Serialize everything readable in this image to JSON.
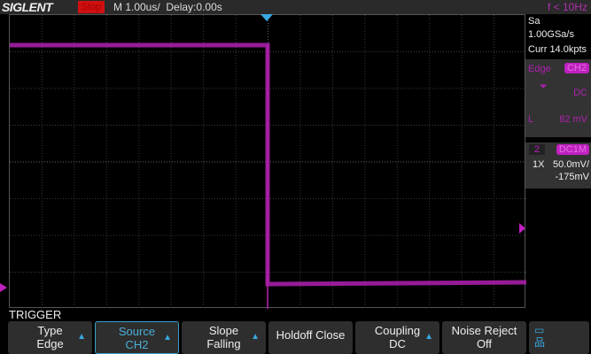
{
  "header": {
    "logo": "SIGLENT",
    "run_state": "Stop",
    "timebase": "M 1.00us/",
    "delay": "Delay:0.00s",
    "frequency": "f < 10Hz"
  },
  "acquisition": {
    "sample_rate": "Sa 1.00GSa/s",
    "memory": "Curr 14.0kpts"
  },
  "trigger_info": {
    "type": "Edge",
    "source": "CH2",
    "coupling": "DC",
    "level_label": "L",
    "level": "82 mV"
  },
  "channel": {
    "number": "2",
    "coupling": "DC1M",
    "probe": "1X",
    "scale": "50.0mV/",
    "offset": "-175mV"
  },
  "menu": {
    "title": "TRIGGER",
    "buttons": [
      {
        "label": "Type",
        "value": "Edge",
        "arrow": true
      },
      {
        "label": "Source",
        "value": "CH2",
        "arrow": true,
        "selected": true
      },
      {
        "label": "Slope",
        "value": "Falling",
        "arrow": true
      },
      {
        "label": "Holdoff Close",
        "value": "",
        "arrow": false
      },
      {
        "label": "Coupling",
        "value": "DC",
        "arrow": true
      },
      {
        "label": "Noise Reject",
        "value": "Off",
        "arrow": false
      }
    ]
  },
  "colors": {
    "ch2": "#b020b0",
    "trigger": "#3aa8e0",
    "stop": "#d01010"
  }
}
